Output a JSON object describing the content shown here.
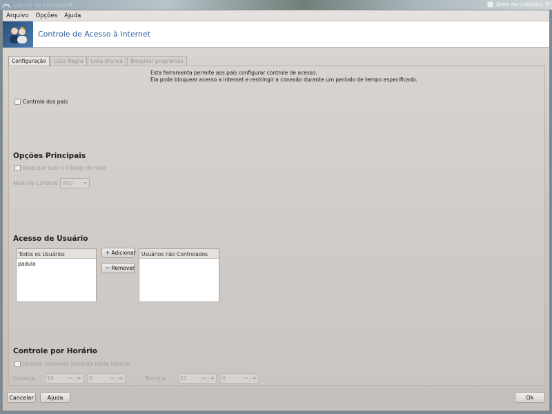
{
  "titlebar": {
    "title": "Centro de Controle M",
    "workspace_label": "Área de trabalho",
    "close_glyph": "×"
  },
  "menu": [
    {
      "label": "Arquivo"
    },
    {
      "label": "Opções"
    },
    {
      "label": "Ajuda"
    }
  ],
  "banner": {
    "title": "Controle de Acesso à Internet",
    "icon": "users-icon"
  },
  "tabs": [
    {
      "label": "Configuração",
      "active": true
    },
    {
      "label": "Lista Negra",
      "active": false
    },
    {
      "label": "Lista Branca",
      "active": false
    },
    {
      "label": "Bloquear programas",
      "active": false
    }
  ],
  "description": {
    "line1": "Esta ferramenta permite aos pais configurar controle de acesso.",
    "line2": "Ela pode bloquear acesso a internet e restringir a conexão durante um período de tempo especificado."
  },
  "parental": {
    "label": "Controle dos pais",
    "checked": false
  },
  "main_options": {
    "title": "Opções Principais",
    "block_all_label": "Bloquear todo o tráfego de rede",
    "level_label": "Nível de Controle",
    "level_value": "Alto"
  },
  "user_access": {
    "title": "Acesso de Usuário",
    "all_users_header": "Todos os Usuários",
    "all_users": [
      "padula"
    ],
    "uncontrolled_header": "Usuários não Controlados",
    "uncontrolled_users": [],
    "add_label": "Adicionar",
    "remove_label": "Remover"
  },
  "schedule": {
    "title": "Controle por Horário",
    "allow_label": "Permitir conexões somente neste horário:",
    "start_label": "Começa:",
    "start_hour": "18",
    "start_minute": "0",
    "end_label": "Termina:",
    "end_hour": "21",
    "end_minute": "0"
  },
  "footer": {
    "cancel": "Cancelar",
    "help": "Ajuda",
    "ok": "Ok"
  },
  "colors": {
    "accent": "#2a5b9a",
    "button_icon": "#2d6fc4"
  }
}
